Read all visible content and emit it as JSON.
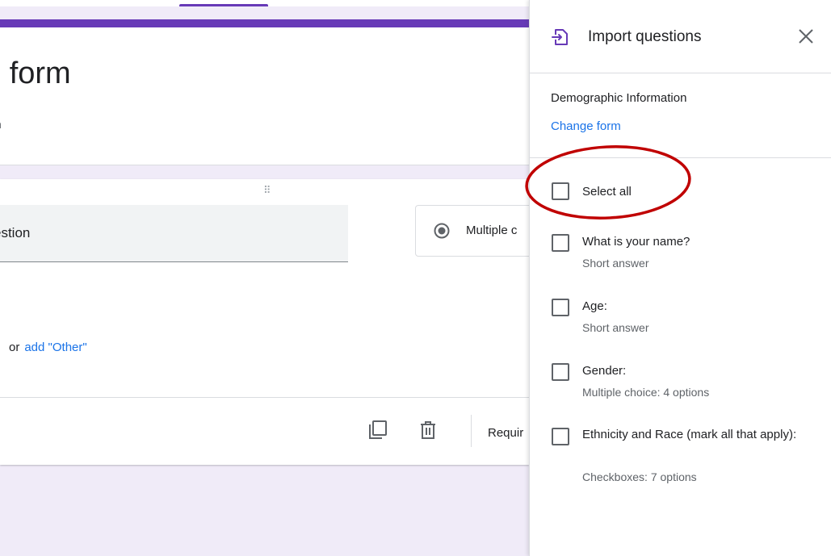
{
  "form": {
    "title": "d form",
    "description": "n"
  },
  "question": {
    "title": "estion",
    "type": "Multiple c",
    "or_text": "or",
    "add_other": "add \"Other\"",
    "required_label": "Requir"
  },
  "import_panel": {
    "title": "Import questions",
    "source_form": "Demographic Information",
    "change_form": "Change form",
    "select_all": "Select all",
    "items": [
      {
        "title": "What is your name?",
        "subtitle": "Short answer"
      },
      {
        "title": "Age:",
        "subtitle": "Short answer"
      },
      {
        "title": "Gender:",
        "subtitle": "Multiple choice: 4 options"
      },
      {
        "title": "Ethnicity and Race (mark all that apply):",
        "subtitle": "Checkboxes: 7 options"
      }
    ]
  },
  "colors": {
    "accent": "#673ab7",
    "link": "#1a73e8",
    "annotation": "#c00000",
    "background": "#f0ebf8"
  }
}
